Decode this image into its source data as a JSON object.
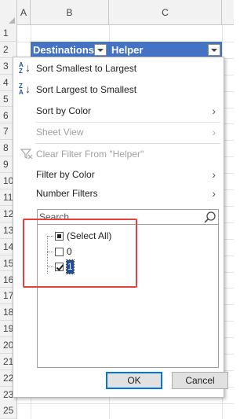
{
  "sheet": {
    "columns": [
      "A",
      "B",
      "C"
    ],
    "rows": [
      "1",
      "2",
      "3",
      "4",
      "5",
      "6",
      "7",
      "8",
      "9",
      "10",
      "11",
      "12",
      "13",
      "14",
      "15",
      "16",
      "17",
      "18",
      "19",
      "20",
      "21",
      "22",
      "23",
      "24",
      "25"
    ]
  },
  "table": {
    "header_destinations": "Destinations",
    "header_helper": "Helper"
  },
  "filter_menu": {
    "sort_asc": "Sort Smallest to Largest",
    "sort_desc": "Sort Largest to Smallest",
    "sort_by_color": "Sort by Color",
    "sheet_view": "Sheet View",
    "clear_filter": "Clear Filter From \"Helper\"",
    "filter_by_color": "Filter by Color",
    "number_filters": "Number Filters",
    "search_placeholder": "Search",
    "values": [
      {
        "label": "(Select All)",
        "state": "partial"
      },
      {
        "label": "0",
        "state": "unchecked"
      },
      {
        "label": "1",
        "state": "checked"
      }
    ],
    "ok_label": "OK",
    "cancel_label": "Cancel"
  },
  "colors": {
    "table_header": "#4472c4",
    "highlight": "#e04242",
    "selection": "#1f4e9c"
  }
}
